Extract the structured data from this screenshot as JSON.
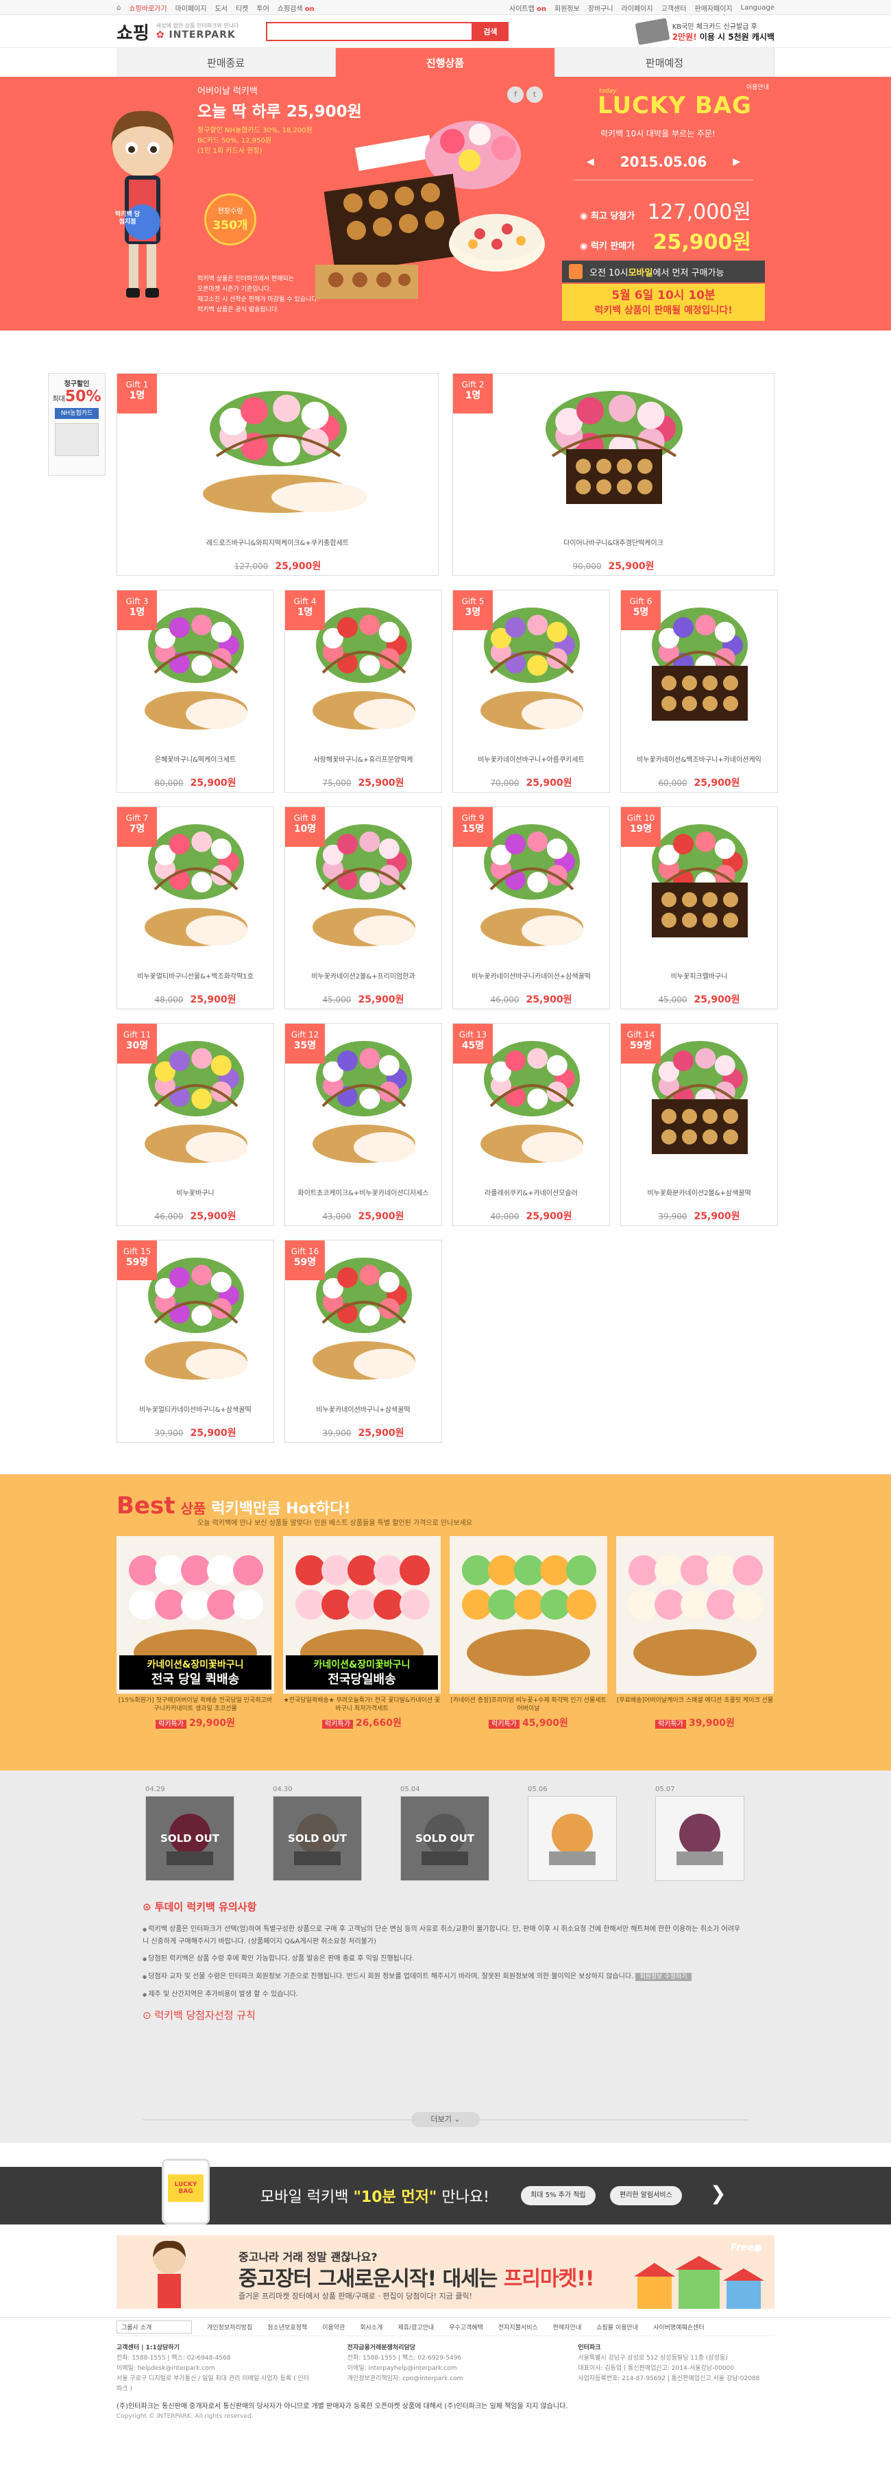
{
  "util": {
    "left": [
      "쇼핑바로가기",
      "마이페이지",
      "도서",
      "티켓",
      "투어",
      "쇼핑검색"
    ],
    "left_on": "on",
    "right": [
      "사이트맵",
      "회원정보",
      "장바구니",
      "라이페이지",
      "고객센터",
      "판매자페이지",
      "Language"
    ],
    "right_on": "on"
  },
  "header": {
    "logo": "쇼핑",
    "logo_sub": "세상에 없던 상품 인터파크와 만나다",
    "logo_brand": "INTERPARK",
    "search_placeholder": "",
    "search_btn": "검색",
    "banner_line1": "KB국민 체크카드 신규발급 후",
    "banner_line2_a": "2만원!",
    "banner_line2_b": " 이용 시 5천원 캐시백"
  },
  "tabs": [
    "판매종료",
    "진행상품",
    "판매예정"
  ],
  "hero": {
    "kicker": "어버이날 럭키백",
    "headline": "오늘 딱 하루 25,900원",
    "desc1": "청구할인 NH농협카드 30%, 18,200원",
    "desc2": "  BC카드 50%, 12,950원",
    "desc3": "(1인 1회 카드사 한정)",
    "badge_top": "현장수령",
    "badge_val": "350개",
    "girl_tag": "럭키백 당첨지점",
    "note1": "럭키백 상품은 인터파크에서 판매되는",
    "note2": "오픈마켓 시즌가 기준입니다.",
    "note3": "재고소진 시 선착순 판매가 마감될 수 있습니다.",
    "note4": "럭키백 상품은 공식 발송됩니다.",
    "share": [
      "f",
      "t"
    ]
  },
  "lucky": {
    "today": "today",
    "logo": "LUCKY BAG",
    "small": "이용안내",
    "sub": "럭키백 10시 대박을 부르는 주문!",
    "date": "2015.05.06",
    "prev": "◀",
    "next": "▶",
    "label1": "최고 당첨가",
    "val1": "127,000원",
    "label2": "럭키 판매가",
    "val2": "25,900원",
    "open_a": "오전 10시 ",
    "open_b": "모바일",
    "open_c": "에서 먼저 구매가능",
    "box1": "5월 6일 10시 10분",
    "box2": "럭키백 상품이 판매될 예정입니다!"
  },
  "sidead": {
    "l1": "청구할인",
    "l2": "최대",
    "l3": "50%",
    "bank": "NH농협카드"
  },
  "gifts": [
    {
      "tag": "Gift 1",
      "count": "1명",
      "name": "레드로즈바구니&와피지떡케이크&+쿠키종합세트",
      "old": "127,000",
      "price": "25,900원"
    },
    {
      "tag": "Gift 2",
      "count": "1명",
      "name": "다이어나바구니&대추경단떡케이크",
      "old": "90,000",
      "price": "25,900원"
    },
    {
      "tag": "Gift 3",
      "count": "1명",
      "name": "은혜꽃바구니&떡케이크세트",
      "old": "80,000",
      "price": "25,900원"
    },
    {
      "tag": "Gift 4",
      "count": "1명",
      "name": "사랑해꽃바구니&+휴리프문양떡케",
      "old": "75,000",
      "price": "25,900원"
    },
    {
      "tag": "Gift 5",
      "count": "3명",
      "name": "비누꽃카네이션바구니+아름쿠키세트",
      "old": "70,000",
      "price": "25,900원"
    },
    {
      "tag": "Gift 6",
      "count": "5명",
      "name": "비누꽃카네이션&백조바구니+카네이션케익",
      "old": "60,000",
      "price": "25,900원"
    },
    {
      "tag": "Gift 7",
      "count": "7명",
      "name": "비누꽃멀티바구니선물&+백조화각떡1호",
      "old": "48,000",
      "price": "25,900원"
    },
    {
      "tag": "Gift 8",
      "count": "10명",
      "name": "비누꽃카네이션2볼&+프리미엄한과",
      "old": "45,000",
      "price": "25,900원"
    },
    {
      "tag": "Gift 9",
      "count": "15명",
      "name": "비누꽃카네이션바구니카네이션+삼색꿀떡",
      "old": "46,000",
      "price": "25,900원"
    },
    {
      "tag": "Gift 10",
      "count": "19명",
      "name": "비누꽃피크렐바구니",
      "old": "45,000",
      "price": "25,900원"
    },
    {
      "tag": "Gift 11",
      "count": "30명",
      "name": "비누꽃바구니",
      "old": "46,000",
      "price": "25,900원"
    },
    {
      "tag": "Gift 12",
      "count": "35명",
      "name": "화이트초코케이크&+비누꽃카네이션디저세스",
      "old": "43,000",
      "price": "25,900원"
    },
    {
      "tag": "Gift 13",
      "count": "45명",
      "name": "라플레쉬쿠키&+카네이션모슬러",
      "old": "40,000",
      "price": "25,900원"
    },
    {
      "tag": "Gift 14",
      "count": "59명",
      "name": "비누꽃화분카네이션2볼&+삼색꿀떡",
      "old": "39,900",
      "price": "25,900원"
    },
    {
      "tag": "Gift 15",
      "count": "59명",
      "name": "비누꽃멀티카네이션바구니&+삼색꿀떡",
      "old": "39,900",
      "price": "25,900원"
    },
    {
      "tag": "Gift 16",
      "count": "59명",
      "name": "비누꽃카네이션바구니+삼색꿀떡",
      "old": "39,900",
      "price": "25,900원"
    }
  ],
  "best": {
    "t1": "Best",
    "t2": "상품",
    "t3": "럭키백만큼 Hot하다!",
    "sub": "오늘 럭키백에 만나 보신 상품들 알맞다! 인원 베스트 상품들을 특별 할인된 가격으로 만나보세요",
    "items": [
      {
        "tag_a": "카네이션&장미꽃바구니",
        "tag_b": "전국 당일 퀵배송",
        "desc": "[15%회원가] 첫구매]어버이날 퀵배송 전국당일 민국최고바구니카카네이트 생과일 초코선물",
        "label": "럭키특가",
        "price": "29,900원"
      },
      {
        "tag_a": "카네이션&장미꽃바구니",
        "tag_b": "전국당일배송",
        "desc": "★전국당일퀵배송★ 무려오늘특가! 전국 꽃다발&카네이션 꽃바구니 최저가격세트",
        "label": "럭키특가",
        "price": "26,660원"
      },
      {
        "tag_a": "",
        "tag_b": "",
        "desc": "[카네이션 증정]프리미엄 비누꽃+수제 화각떡 인기 선물세트 어버이날",
        "label": "럭키특가",
        "price": "45,900원"
      },
      {
        "tag_a": "",
        "tag_b": "",
        "desc": "[무료배송]어버이날케이크 스페셜 에디션 초콜릿 케이크 선물",
        "label": "럭키특가",
        "price": "39,900원"
      }
    ]
  },
  "history": [
    {
      "date": "04.29",
      "sold": "SOLD OUT"
    },
    {
      "date": "04.30",
      "sold": "SOLD OUT"
    },
    {
      "date": "05.04",
      "sold": "SOLD OUT"
    },
    {
      "date": "05.06",
      "sold": ""
    },
    {
      "date": "05.07",
      "sold": ""
    }
  ],
  "notice": {
    "title": "투데이 럭키백 유의사항",
    "items": [
      "럭키백 상품은 인터파크가 선택(엄)하여 특별구성한 상품으로 구매 후 고객님의 단순 변심 등의 사유로 취소/교환이 불가합니다. 단, 판매 이후 시 취소요청 건에 한해서만 해트쳐에 한한 이용하는 취소가 어려우니 신중하게 구매해주시기 바랍니다. (상품페이지 Q&A게시판 취소요청 처리불가)",
      "당첨된 럭키백은 상품 수령 후에 확인 가능합니다. 상품 발송은 판매 종료 후 익일 진행됩니다.",
      "당첨자 교차 및 선물 수령은 인터파크 회원정보 기준으로 진행됩니다. 반드시 회원 정보를 업데이트 해주시기 바라며, 잘못된 회원정보에 의한 불이익은 보상하지 않습니다.",
      "제주 및 산간지역은 추가비용이 발생 할 수 있습니다."
    ],
    "badge": "회원정보 수정하기",
    "title2": "럭키백 당첨자선정 규칙",
    "more": "더보기"
  },
  "app": {
    "phone": "LUCKY BAG",
    "t_a": "모바일 럭키백 ",
    "t_b": "\"10분 먼저\"",
    "t_c": " 만나요!",
    "b1": "최대 5% 추가 적립",
    "b2": "편리한 알림서비스"
  },
  "used": {
    "t1": "중고나라 거래 정말 괜찮나요?",
    "t2_a": "중고장터 그새로운시작! 대세는 ",
    "t2_b": "프리마켓!!",
    "t3": "즐거운 프리마켓 장터에서 상품 판매/구매로 · 편집이 당첨이다! 지금 클릭!",
    "free": "Free●"
  },
  "footer": {
    "links": [
      "그룹사 소개",
      "개인정보처리방침",
      "청소년보호정책",
      "이용약관",
      "회사소개",
      "제휴/광고안내",
      "우수고객혜택",
      "전자지불서비스",
      "판매자안내",
      "쇼핑몰 이용안내",
      "사이버명예훼손센터"
    ],
    "c1": [
      "고객센터 | 1:1상담하기",
      "전화: 1588-1555 | 팩스: 02-6948-4568",
      "이메일: helpdesk@interpark.com",
      "서울 구로구 디지털로 부가통신 / 일일 최대 관리 이메일 사업자 등록 ( 인터파크 )"
    ],
    "c2": [
      "전자금융거래분쟁처리담당",
      "전화: 1588-1555 | 팩스: 02-6929-5496",
      "이메일: interpayhelp@interpark.com",
      "개인정보관리책임자: cpo@interpark.com"
    ],
    "c3": [
      "인터파크",
      "서울특별시 강남구 삼성로 512 삼성동빌딩 11층 (삼성동)",
      "대표이사: 김동업 | 통신판매업신고: 2014-서울강남-00000",
      "사업자등록번호: 214-87-95692 | 통신판매업신고 서울 강남-02088"
    ],
    "b1": "(주)인터파크는 통신판매 중개자로서 통신판매의 당사자가 아니므로 개별 판매자가 등록한 오픈마켓 상품에 대해서 (주)인터파크는 일체 책임을 지지 않습니다.",
    "copy": "Copyright © INTERPARK. All rights reserved."
  }
}
